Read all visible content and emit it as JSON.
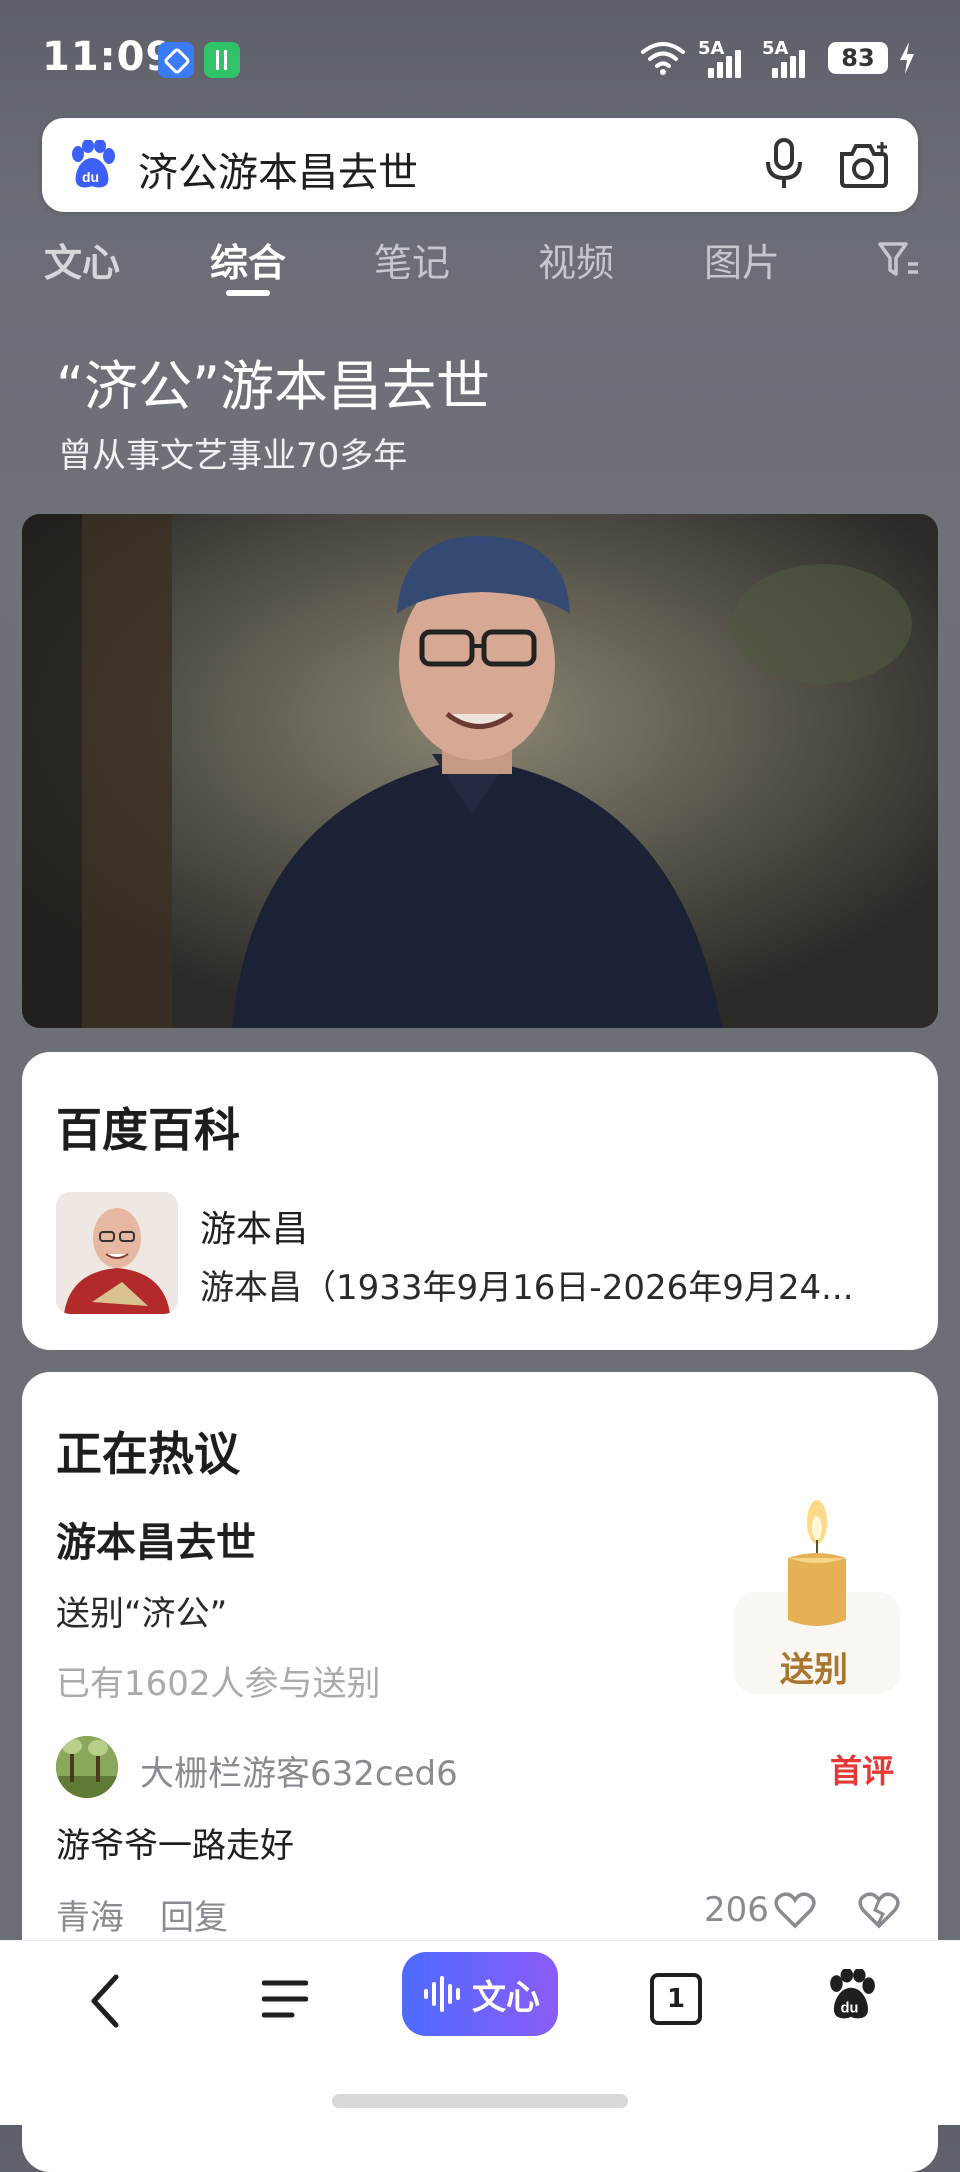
{
  "status_bar": {
    "time": "11:09",
    "signal_1_label": "5A",
    "signal_2_label": "5A",
    "battery": "83"
  },
  "search": {
    "query": "济公游本昌去世"
  },
  "tabs": [
    {
      "label": "文心"
    },
    {
      "label": "综合"
    },
    {
      "label": "笔记"
    },
    {
      "label": "视频"
    },
    {
      "label": "图片"
    }
  ],
  "headline": {
    "title": "“济公”游本昌去世",
    "subtitle": "曾从事文艺事业70多年"
  },
  "baike": {
    "section_title": "百度百科",
    "entry_title": "游本昌",
    "entry_desc": "游本昌（1933年9月16日-2026年9月24..."
  },
  "hot_discussion": {
    "section_title": "正在热议",
    "topic_title": "游本昌去世",
    "topic_sub": "送别“济公”",
    "participants": "已有1602人参与送别",
    "farewell_button": "送别",
    "comment": {
      "username": "大栅栏游客632ced6",
      "badge": "首评",
      "text": "游爷爷一路走好",
      "location": "青海",
      "reply": "回复",
      "likes": "206"
    }
  },
  "bottom_nav": {
    "wenxin_label": "文心",
    "tabs_count": "1"
  },
  "colors": {
    "accent_red": "#e53935",
    "wenxin_gradient_start": "#4e6bff",
    "wenxin_gradient_end": "#8a5cf6"
  }
}
